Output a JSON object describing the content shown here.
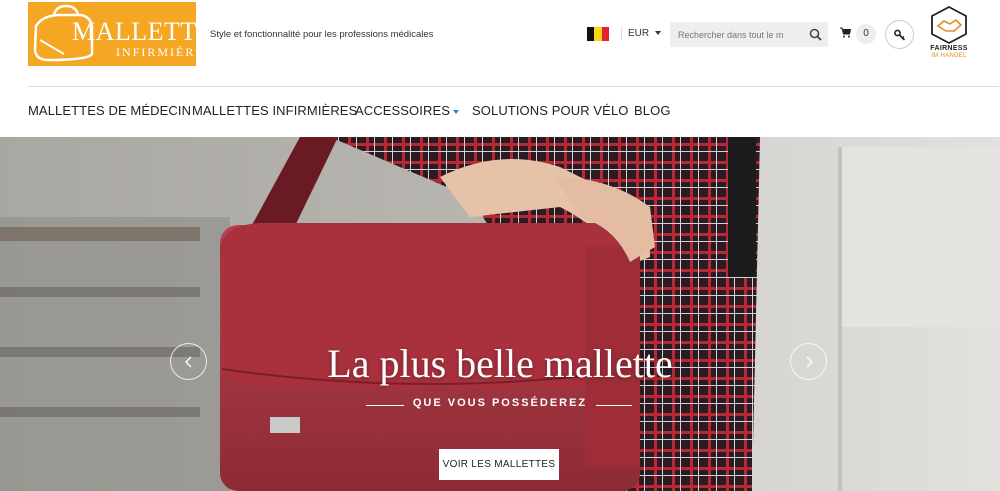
{
  "header": {
    "logo": {
      "title": "MALLETTE",
      "subtitle": "INFIRMIÈRE"
    },
    "tagline": "Style et fonctionnalité pour les professions médicales",
    "currency": "EUR",
    "search": {
      "placeholder": "Rechercher dans tout le m"
    },
    "cart": {
      "count": "0"
    },
    "fairness": {
      "line1": "FAIRNESS",
      "line2": "IM HANDEL"
    },
    "colors": {
      "logo_bg": "#f5a623",
      "flag_black": "#111111",
      "flag_yellow": "#f9d616",
      "flag_red": "#e6202c"
    }
  },
  "nav": {
    "items": [
      {
        "label": "MALLETTES DE MÉDECIN"
      },
      {
        "label": "MALLETTES INFIRMIÈRES"
      },
      {
        "label": "ACCESSOIRES",
        "has_dropdown": true
      },
      {
        "label": "SOLUTIONS POUR VÉLO"
      },
      {
        "label": "BLOG"
      }
    ]
  },
  "hero": {
    "title": "La plus belle mallette",
    "subtitle": "QUE VOUS POSSÉDEREZ",
    "cta": "VOIR LES MALLETTES"
  },
  "icons": [
    "logo-bag-icon",
    "flag-belgium-icon",
    "chevron-down-icon",
    "search-icon",
    "cart-icon",
    "key-icon",
    "handshake-icon",
    "chevron-left-icon",
    "chevron-right-icon"
  ]
}
